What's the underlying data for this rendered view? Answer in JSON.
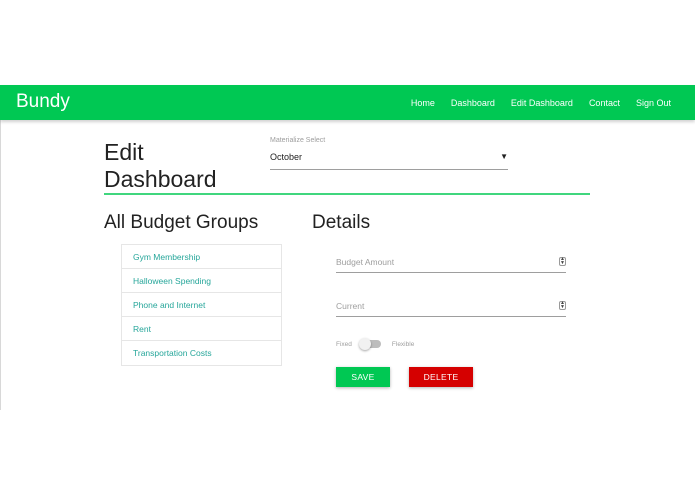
{
  "navbar": {
    "brand": "Bundy",
    "links": [
      {
        "label": "Home"
      },
      {
        "label": "Dashboard"
      },
      {
        "label": "Edit Dashboard"
      },
      {
        "label": "Contact"
      },
      {
        "label": "Sign Out"
      }
    ],
    "color": "#00c853"
  },
  "header": {
    "title": "Edit Dashboard",
    "select": {
      "label": "Materialize Select",
      "value": "October",
      "arrow": "▼"
    }
  },
  "budget_groups": {
    "heading": "All Budget Groups",
    "items": [
      {
        "label": "Gym Membership"
      },
      {
        "label": "Halloween Spending"
      },
      {
        "label": "Phone and Internet"
      },
      {
        "label": "Rent"
      },
      {
        "label": "Transportation Costs"
      }
    ],
    "link_color": "#26a69a"
  },
  "details": {
    "heading": "Details",
    "budget_amount_placeholder": "Budget Amount",
    "current_placeholder": "Current",
    "switch": {
      "off_label": "Fixed",
      "on_label": "Flexible",
      "checked": false
    },
    "save_label": "SAVE",
    "delete_label": "DELETE",
    "save_color": "#00c853",
    "delete_color": "#d50000"
  }
}
